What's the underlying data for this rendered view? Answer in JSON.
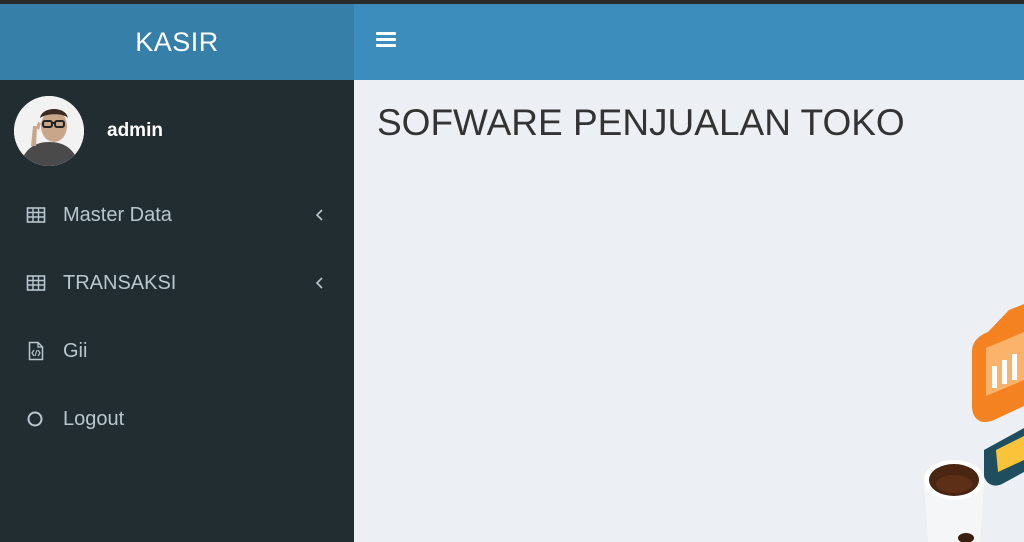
{
  "app": {
    "title": "KASIR"
  },
  "user": {
    "name": "admin"
  },
  "sidebar": {
    "items": [
      {
        "label": "Master Data",
        "icon": "table-icon",
        "has_submenu": true
      },
      {
        "label": "TRANSAKSI",
        "icon": "table-icon",
        "has_submenu": true
      },
      {
        "label": "Gii",
        "icon": "file-code-icon",
        "has_submenu": false
      },
      {
        "label": "Logout",
        "icon": "circle-icon",
        "has_submenu": false
      }
    ]
  },
  "main": {
    "title": "SOFWARE PENJUALAN TOKO"
  },
  "colors": {
    "header_logo": "#367fa9",
    "header_nav": "#3c8dbc",
    "sidebar_bg": "#222d32",
    "sidebar_text": "#b8c7ce",
    "content_bg": "#ecf0f5"
  }
}
